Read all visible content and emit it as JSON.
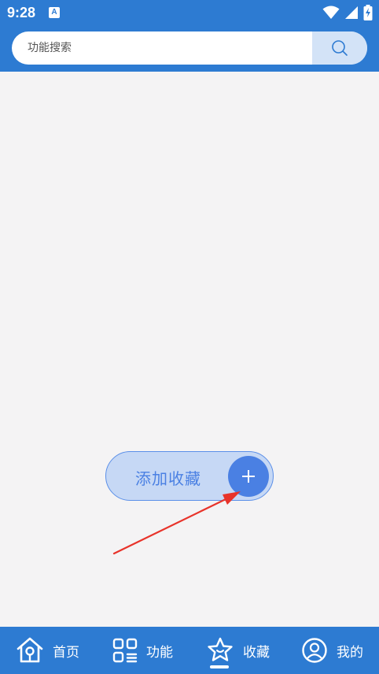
{
  "status_bar": {
    "time": "9:28",
    "notification_icon": "A",
    "icons": [
      "wifi-icon",
      "signal-icon",
      "battery-charging-icon"
    ]
  },
  "search": {
    "placeholder": "功能搜索",
    "button_icon": "search-icon"
  },
  "add_favorite": {
    "label": "添加收藏",
    "icon": "plus-icon"
  },
  "annotation": {
    "icon": "red-arrow-icon",
    "color": "#e8332a"
  },
  "bottom_nav": {
    "items": [
      {
        "label": "首页",
        "icon": "home-icon"
      },
      {
        "label": "功能",
        "icon": "apps-icon"
      },
      {
        "label": "收藏",
        "icon": "star-icon",
        "active": true
      },
      {
        "label": "我的",
        "icon": "profile-icon"
      }
    ]
  },
  "colors": {
    "primary": "#2d7bd2",
    "background": "#f4f3f4",
    "accent": "#4a80e3",
    "accent_light": "#c6d8f5"
  }
}
